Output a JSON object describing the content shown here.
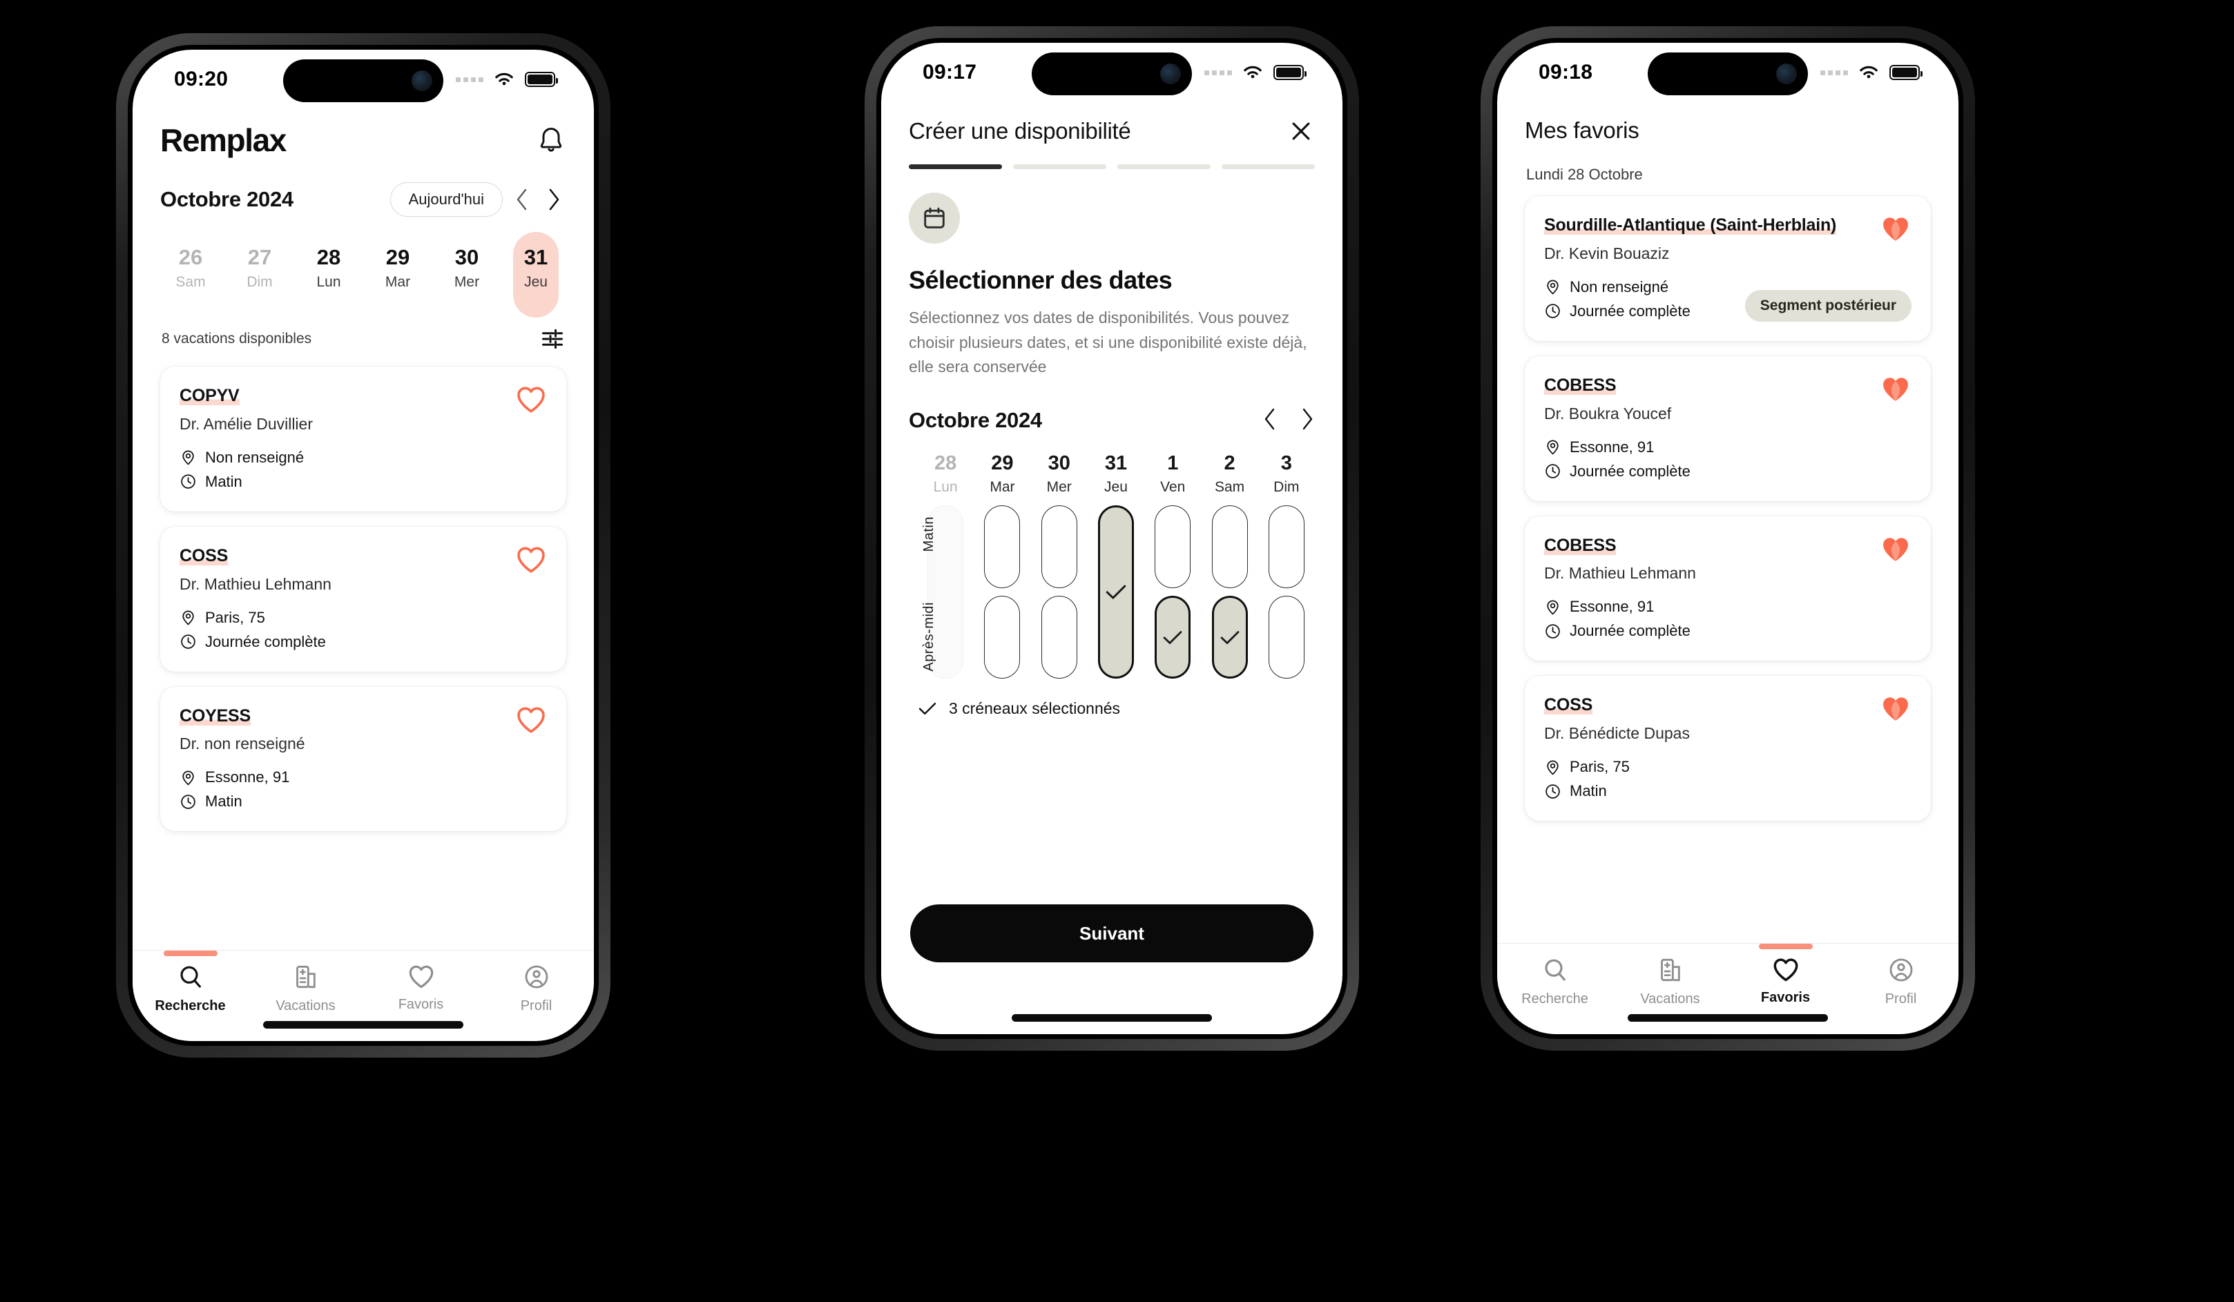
{
  "phones": [
    {
      "id": "search",
      "status": {
        "time": "09:20"
      },
      "brand": "Remplax",
      "bell_icon": "bell-icon",
      "calendar": {
        "month": "Octobre 2024",
        "today_label": "Aujourd'hui",
        "prev_icon": "chevron-left-icon",
        "next_icon": "chevron-right-icon",
        "days": [
          {
            "num": "26",
            "dow": "Sam",
            "state": "dim"
          },
          {
            "num": "27",
            "dow": "Dim",
            "state": "dim"
          },
          {
            "num": "28",
            "dow": "Lun",
            "state": "normal"
          },
          {
            "num": "29",
            "dow": "Mar",
            "state": "normal"
          },
          {
            "num": "30",
            "dow": "Mer",
            "state": "normal"
          },
          {
            "num": "31",
            "dow": "Jeu",
            "state": "active"
          }
        ]
      },
      "count_text": "8 vacations disponibles",
      "filter_icon": "sliders-icon",
      "cards": [
        {
          "title": "COPYV",
          "doctor": "Dr. Amélie Duvillier",
          "location": "Non renseigné",
          "time": "Matin",
          "favorite": false
        },
        {
          "title": "COSS",
          "doctor": "Dr. Mathieu Lehmann",
          "location": "Paris, 75",
          "time": "Journée complète",
          "favorite": false
        },
        {
          "title": "COYESS",
          "doctor": "Dr. non renseigné",
          "location": "Essonne, 91",
          "time": "Matin",
          "favorite": false
        }
      ],
      "tabs": [
        {
          "label": "Recherche",
          "icon": "search-icon",
          "active": true
        },
        {
          "label": "Vacations",
          "icon": "hospital-icon",
          "active": false
        },
        {
          "label": "Favoris",
          "icon": "heart-icon",
          "active": false
        },
        {
          "label": "Profil",
          "icon": "user-circle-icon",
          "active": false
        }
      ]
    },
    {
      "id": "create-availability",
      "status": {
        "time": "09:17"
      },
      "header": {
        "title": "Créer une disponibilité",
        "close_icon": "close-icon"
      },
      "steps": {
        "total": 4,
        "current": 1
      },
      "badge_icon": "calendar-icon",
      "heading": "Sélectionner des dates",
      "description": "Sélectionnez vos dates de disponibilités. Vous pouvez choisir plusieurs dates, et si une disponibilité existe déjà, elle sera conservée",
      "calendar": {
        "month": "Octobre 2024",
        "prev_icon": "chevron-left-icon",
        "next_icon": "chevron-right-icon",
        "row_labels": [
          "Matin",
          "Après-midi"
        ],
        "columns": [
          {
            "num": "28",
            "dow": "Lun",
            "disabled": true,
            "morning": "disabled",
            "afternoon": "disabled"
          },
          {
            "num": "29",
            "dow": "Mar",
            "disabled": false,
            "morning": "empty",
            "afternoon": "empty"
          },
          {
            "num": "30",
            "dow": "Mer",
            "disabled": false,
            "morning": "empty",
            "afternoon": "empty"
          },
          {
            "num": "31",
            "dow": "Jeu",
            "disabled": false,
            "morning": "fullday-selected",
            "afternoon": "merged"
          },
          {
            "num": "1",
            "dow": "Ven",
            "disabled": false,
            "morning": "empty",
            "afternoon": "selected"
          },
          {
            "num": "2",
            "dow": "Sam",
            "disabled": false,
            "morning": "empty",
            "afternoon": "selected"
          },
          {
            "num": "3",
            "dow": "Dim",
            "disabled": false,
            "morning": "empty",
            "afternoon": "empty"
          }
        ]
      },
      "selected_note": "3 créneaux sélectionnés",
      "selected_note_icon": "check-icon",
      "primary_button": "Suivant"
    },
    {
      "id": "favorites",
      "status": {
        "time": "09:18"
      },
      "title": "Mes favoris",
      "date_label": "Lundi 28 Octobre",
      "cards": [
        {
          "title": "Sourdille-Atlantique (Saint-Herblain)",
          "doctor": "Dr. Kevin Bouaziz",
          "location": "Non renseigné",
          "time": "Journée complète",
          "favorite": true,
          "badge": "Segment postérieur"
        },
        {
          "title": "COBESS",
          "doctor": "Dr. Boukra Youcef",
          "location": "Essonne, 91",
          "time": "Journée complète",
          "favorite": true,
          "badge": ""
        },
        {
          "title": "COBESS",
          "doctor": "Dr. Mathieu Lehmann",
          "location": "Essonne, 91",
          "time": "Journée complète",
          "favorite": true,
          "badge": ""
        },
        {
          "title": "COSS",
          "doctor": "Dr. Bénédicte Dupas",
          "location": "Paris, 75",
          "time": "Matin",
          "favorite": true,
          "badge": ""
        }
      ],
      "tabs": [
        {
          "label": "Recherche",
          "icon": "search-icon",
          "active": false
        },
        {
          "label": "Vacations",
          "icon": "hospital-icon",
          "active": false
        },
        {
          "label": "Favoris",
          "icon": "heart-icon",
          "active": true
        },
        {
          "label": "Profil",
          "icon": "user-circle-icon",
          "active": false
        }
      ]
    }
  ],
  "colors": {
    "accent_coral": "#FA6B4E",
    "accent_pink_highlight": "#FBD9D0",
    "accent_tab_indicator": "#F8907B",
    "beige": "#E2E1D8",
    "slot_selected": "#DAD9CE",
    "ink": "#0d0d0d",
    "page_background": "#000000"
  }
}
